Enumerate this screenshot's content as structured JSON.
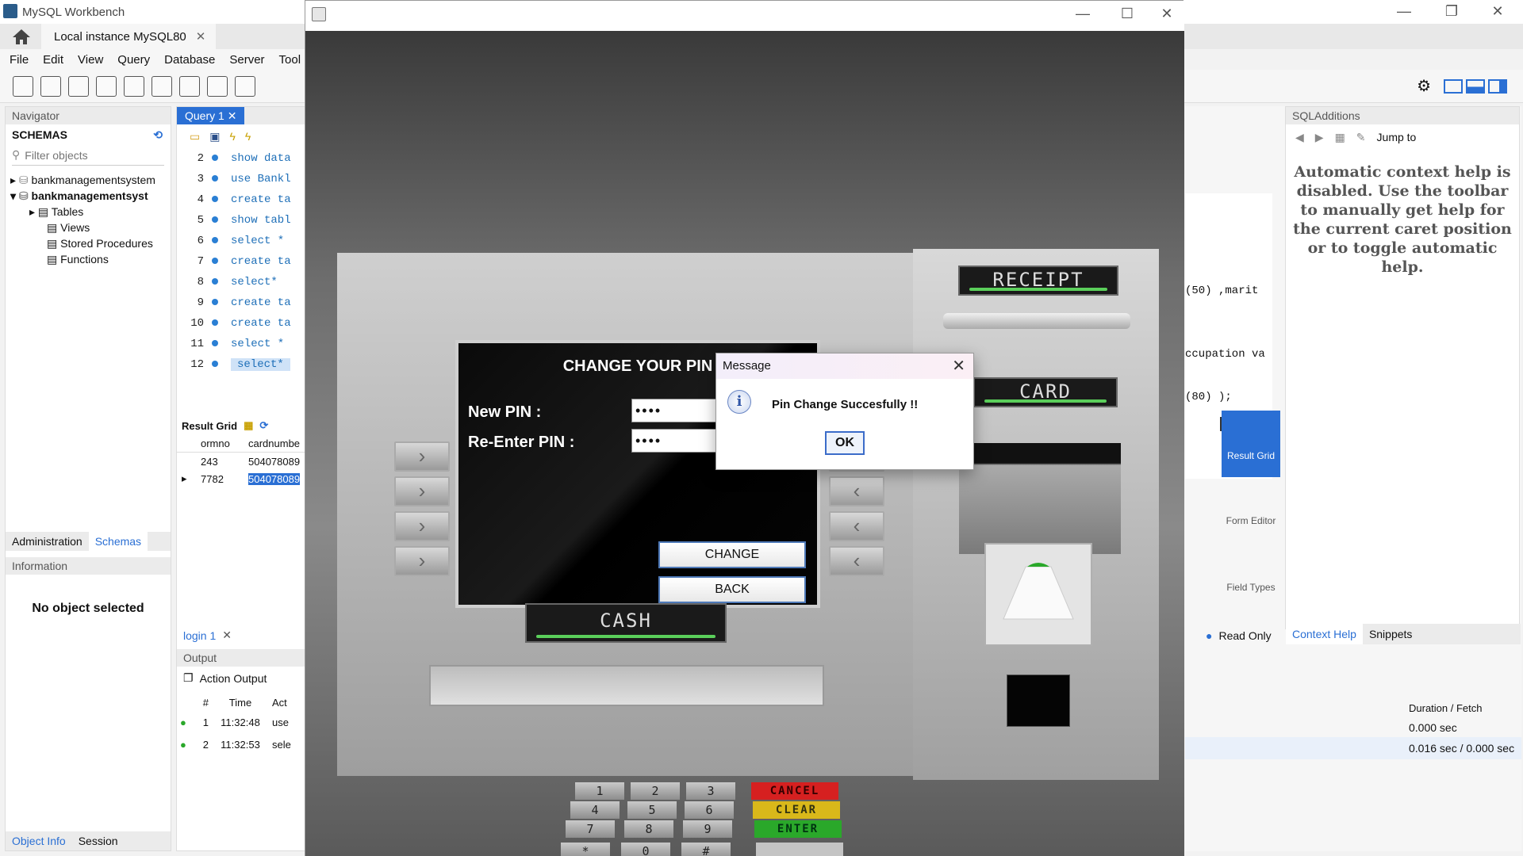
{
  "workbench": {
    "title": "MySQL Workbench",
    "tab": "Local instance MySQL80",
    "menu": [
      "File",
      "Edit",
      "View",
      "Query",
      "Database",
      "Server",
      "Tool"
    ],
    "navigator": {
      "header": "Navigator",
      "schemas_label": "SCHEMAS",
      "filter_placeholder": "Filter objects",
      "tree": [
        "bankmanagementsystem",
        "bankmanagementsyst",
        "Tables",
        "Views",
        "Stored Procedures",
        "Functions"
      ],
      "tabs": [
        "Administration",
        "Schemas"
      ],
      "info_header": "Information",
      "no_object": "No object selected",
      "bottom_tabs": [
        "Object Info",
        "Session"
      ]
    },
    "query": {
      "tab": "Query 1",
      "lines": [
        {
          "n": "2",
          "text": "show data"
        },
        {
          "n": "3",
          "text": "use Bankl"
        },
        {
          "n": "4",
          "text": "create ta"
        },
        {
          "n": "5",
          "text": "show tabl"
        },
        {
          "n": "6",
          "text": "select *"
        },
        {
          "n": "7",
          "text": "create ta"
        },
        {
          "n": "8",
          "text": "select* "
        },
        {
          "n": "9",
          "text": "create ta"
        },
        {
          "n": "10",
          "text": "create ta"
        },
        {
          "n": "11",
          "text": "select *"
        },
        {
          "n": "12",
          "text": "select*"
        }
      ],
      "result_grid_label": "Result Grid",
      "columns": [
        "ormno",
        "cardnumbe"
      ],
      "rows": [
        [
          "243",
          "504078089"
        ],
        [
          "7782",
          "504078089"
        ]
      ],
      "login_tab": "login 1",
      "output_label": "Output",
      "action_output": "Action Output",
      "out_cols": [
        "#",
        "Time",
        "Act"
      ],
      "out_rows": [
        [
          "1",
          "11:32:48",
          "use"
        ],
        [
          "2",
          "11:32:53",
          "sele"
        ]
      ]
    },
    "right_code": [
      "(50) ,marit",
      "ccupation va",
      "(80) );"
    ],
    "sqladditions": {
      "header": "SQLAdditions",
      "jump": "Jump to",
      "help": "Automatic context help is disabled. Use the toolbar to manually get help for the current caret position or to toggle automatic help.",
      "tabs": [
        "Context Help",
        "Snippets"
      ]
    },
    "side_tools": [
      "Result Grid",
      "Form Editor",
      "Field Types"
    ],
    "read_only": "Read Only",
    "duration_header": "Duration / Fetch",
    "durations": [
      "0.000 sec",
      "0.016 sec / 0.000 sec"
    ]
  },
  "atm": {
    "screen_title": "CHANGE YOUR PIN",
    "new_pin_label": "New PIN :",
    "reenter_label": "Re-Enter PIN :",
    "pin_mask": "••••",
    "change_label": "CHANGE",
    "back_label": "BACK",
    "cash_label": "CASH",
    "receipt_label": "RECEIPT",
    "card_label": "CARD",
    "keys": [
      "1",
      "2",
      "3",
      "4",
      "5",
      "6",
      "7",
      "8",
      "9",
      "*",
      "0",
      "#"
    ],
    "fkeys": [
      {
        "label": "CANCEL",
        "color": "#d62020"
      },
      {
        "label": "CLEAR",
        "color": "#d9b81a"
      },
      {
        "label": "ENTER",
        "color": "#2aa82a"
      },
      {
        "label": "",
        "color": "#c4c4c4"
      }
    ]
  },
  "dialog": {
    "title": "Message",
    "message": "Pin Change Succesfully !!",
    "ok": "OK"
  }
}
